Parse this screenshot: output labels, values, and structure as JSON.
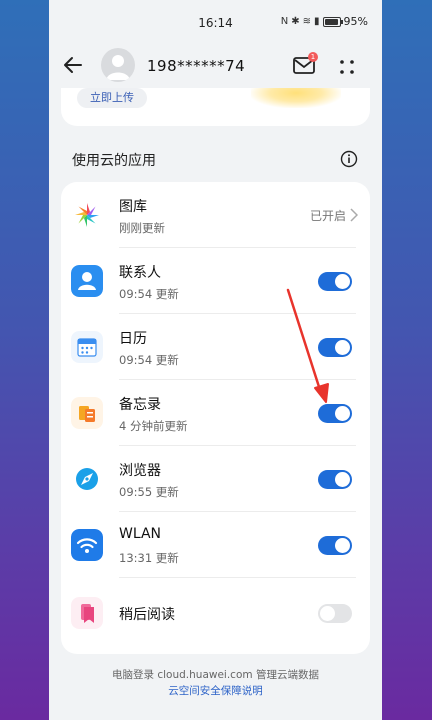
{
  "status_bar": {
    "time": "16:14",
    "battery": "95%",
    "icons": [
      "nfc-icon",
      "bluetooth-icon",
      "wifi-icon",
      "signal-icon",
      "battery-icon"
    ]
  },
  "header": {
    "account": "198******74",
    "mail_badge": "1"
  },
  "top_card": {
    "upload_label": "立即上传"
  },
  "section": {
    "title": "使用云的应用"
  },
  "apps": [
    {
      "name": "图库",
      "sub": "刚刚更新",
      "status": "已开启",
      "control": "chevron",
      "icon": "gallery-icon"
    },
    {
      "name": "联系人",
      "sub": "09:54 更新",
      "toggle": true,
      "icon": "contacts-icon"
    },
    {
      "name": "日历",
      "sub": "09:54 更新",
      "toggle": true,
      "icon": "calendar-icon"
    },
    {
      "name": "备忘录",
      "sub": "4 分钟前更新",
      "toggle": true,
      "icon": "notes-icon"
    },
    {
      "name": "浏览器",
      "sub": "09:55 更新",
      "toggle": true,
      "icon": "browser-icon"
    },
    {
      "name": "WLAN",
      "sub": "13:31 更新",
      "toggle": true,
      "icon": "wlan-icon"
    },
    {
      "name": "稍后阅读",
      "sub": "",
      "toggle": false,
      "icon": "read-later-icon"
    }
  ],
  "footer": {
    "line1": "电脑登录 cloud.huawei.com 管理云端数据",
    "line2": "云空间安全保障说明"
  },
  "colors": {
    "accent": "#1e6cd8",
    "link": "#2d63c8",
    "annotation_arrow": "#e8342c"
  }
}
